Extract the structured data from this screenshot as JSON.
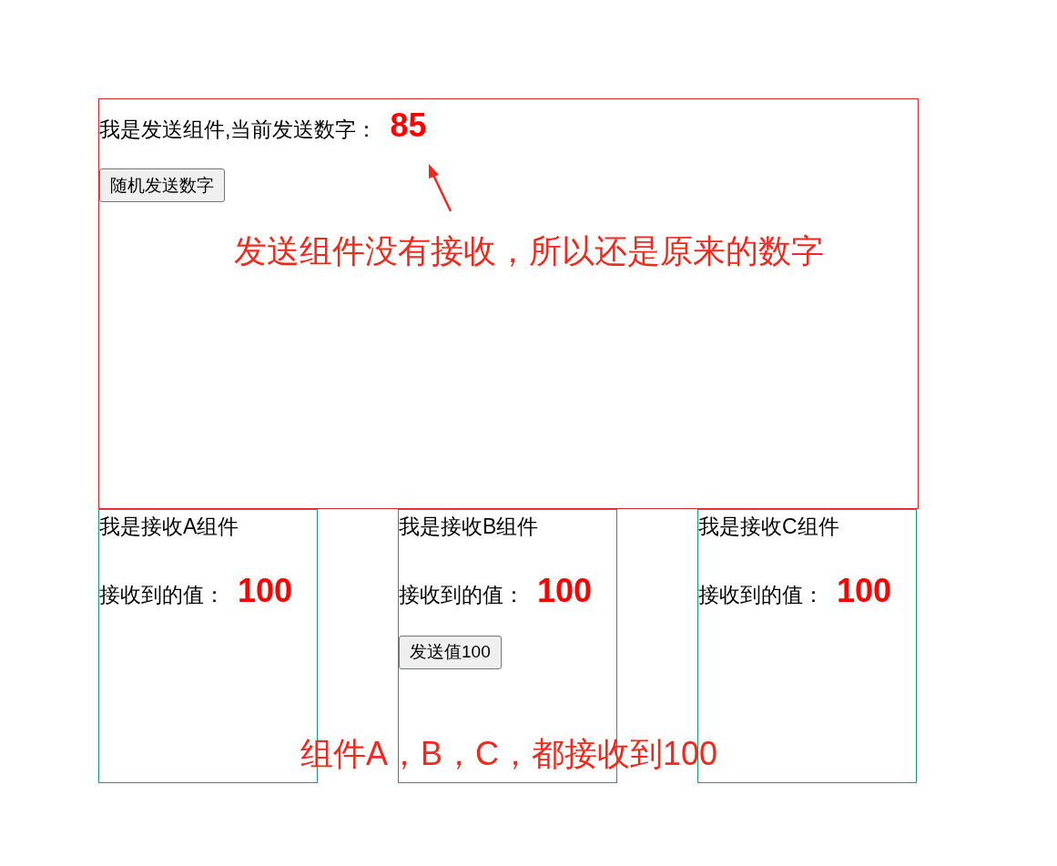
{
  "sender": {
    "label": "我是发送组件,当前发送数字：",
    "value": "85",
    "button": "随机发送数字"
  },
  "receivers": [
    {
      "title": "我是接收A组件",
      "label": "接收到的值：",
      "value": "100"
    },
    {
      "title": "我是接收B组件",
      "label": "接收到的值：",
      "value": "100",
      "button": "发送值100"
    },
    {
      "title": "我是接收C组件",
      "label": "接收到的值：",
      "value": "100"
    }
  ],
  "annotations": [
    {
      "text": "发送组件没有接收，所以还是原来的数字",
      "arrow": true
    },
    {
      "text": "组件A，B，C，都接收到100",
      "arrow": false
    }
  ]
}
